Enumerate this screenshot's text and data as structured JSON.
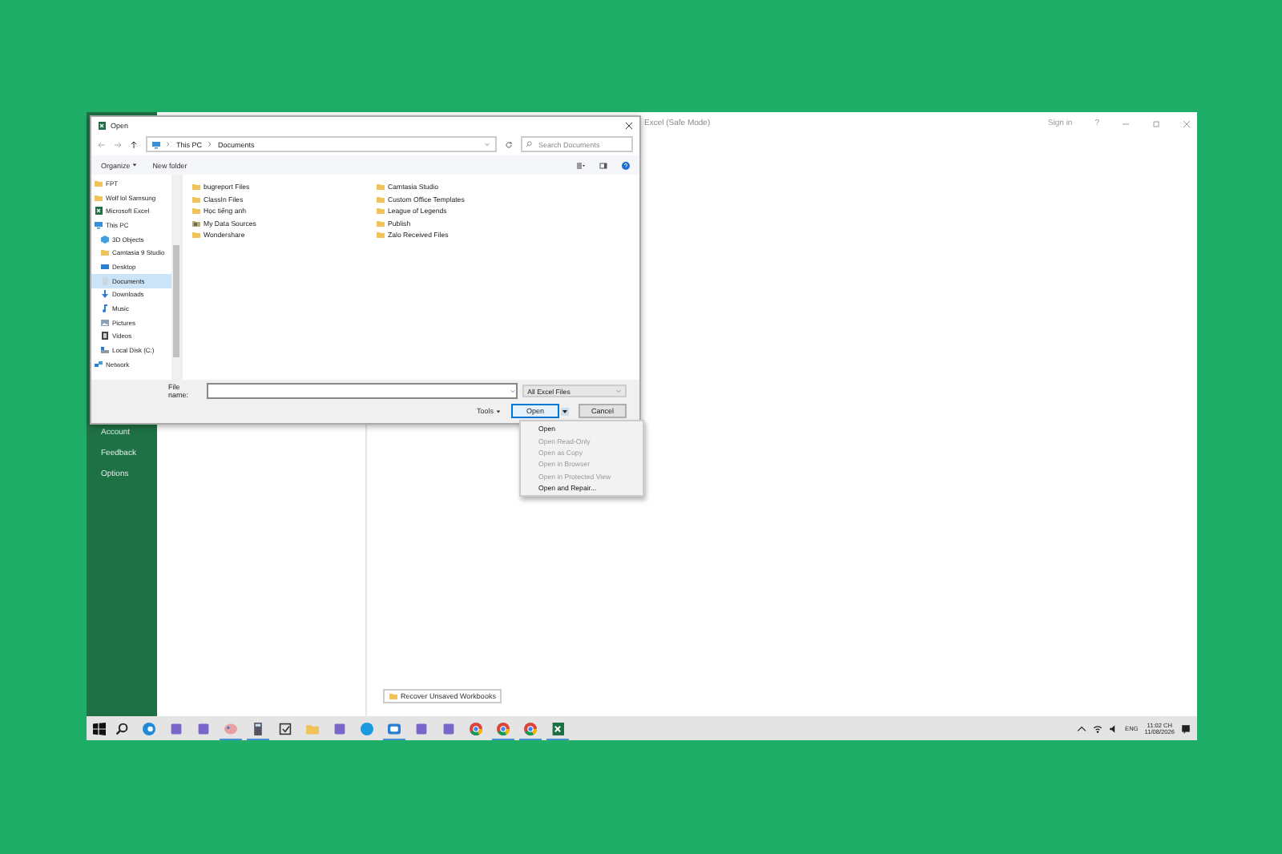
{
  "excel": {
    "title": "Excel (Safe Mode)",
    "sign_in": "Sign in",
    "help": "?",
    "backstage": [
      {
        "label": "Account"
      },
      {
        "label": "Feedback"
      },
      {
        "label": "Options"
      }
    ],
    "recover_button": "Recover Unsaved Workbooks"
  },
  "dialog": {
    "title": "Open",
    "path": [
      "This PC",
      "Documents"
    ],
    "search": {
      "placeholder": "Search Documents"
    },
    "organize": "Organize",
    "new_folder": "New folder",
    "nav": [
      {
        "label": "FPT",
        "kind": "folder",
        "selected": false
      },
      {
        "label": "Wolf lol Samsung",
        "kind": "folder",
        "selected": false
      },
      {
        "label": "Microsoft Excel",
        "kind": "excel",
        "selected": false
      },
      {
        "label": "This PC",
        "kind": "pc",
        "selected": false,
        "children": [
          {
            "label": "3D Objects",
            "kind": "cube",
            "selected": false
          },
          {
            "label": "Camtasia 9 Studio",
            "kind": "folder",
            "selected": false
          },
          {
            "label": "Desktop",
            "kind": "desktop",
            "selected": false
          },
          {
            "label": "Documents",
            "kind": "docs",
            "selected": true
          },
          {
            "label": "Downloads",
            "kind": "download",
            "selected": false
          },
          {
            "label": "Music",
            "kind": "music",
            "selected": false
          },
          {
            "label": "Pictures",
            "kind": "pictures",
            "selected": false
          },
          {
            "label": "Videos",
            "kind": "videos",
            "selected": false
          },
          {
            "label": "Local Disk (C:)",
            "kind": "disk",
            "selected": false
          }
        ]
      },
      {
        "label": "Network",
        "kind": "network",
        "selected": false
      }
    ],
    "files": [
      {
        "name": "bugreport Files",
        "kind": "folder"
      },
      {
        "name": "ClassIn Files",
        "kind": "folder"
      },
      {
        "name": "Học tiếng anh",
        "kind": "folder"
      },
      {
        "name": "My Data Sources",
        "kind": "datasource"
      },
      {
        "name": "Wondershare",
        "kind": "folder"
      },
      {
        "name": "Camtasia Studio",
        "kind": "folder"
      },
      {
        "name": "Custom Office Templates",
        "kind": "folder"
      },
      {
        "name": "League of Legends",
        "kind": "folder"
      },
      {
        "name": "Publish",
        "kind": "folder"
      },
      {
        "name": "Zalo Received Files",
        "kind": "folder"
      }
    ],
    "file_name_label": "File name:",
    "filter": "All Excel Files",
    "tools": "Tools",
    "open": "Open",
    "cancel": "Cancel",
    "open_menu": [
      {
        "label": "Open",
        "disabled": false
      },
      {
        "label": "Open Read-Only",
        "disabled": true
      },
      {
        "label": "Open as Copy",
        "disabled": true
      },
      {
        "label": "Open in Browser",
        "disabled": true
      },
      {
        "label": "Open in Protected View",
        "disabled": true
      },
      {
        "label": "Open and Repair...",
        "disabled": false
      }
    ]
  },
  "taskbar": {
    "apps": [
      {
        "kind": "search",
        "running": false
      },
      {
        "kind": "edge",
        "running": false
      },
      {
        "kind": "app",
        "running": false
      },
      {
        "kind": "app",
        "running": false
      },
      {
        "kind": "paint",
        "running": true
      },
      {
        "kind": "calc",
        "running": true
      },
      {
        "kind": "check",
        "running": false
      },
      {
        "kind": "folder",
        "running": false
      },
      {
        "kind": "app",
        "running": false
      },
      {
        "kind": "skype",
        "running": false
      },
      {
        "kind": "zalo",
        "running": true
      },
      {
        "kind": "app",
        "running": false
      },
      {
        "kind": "app",
        "running": false
      },
      {
        "kind": "chrome",
        "running": false
      },
      {
        "kind": "chrome",
        "running": true
      },
      {
        "kind": "chrome",
        "running": true
      },
      {
        "kind": "excel",
        "running": true
      }
    ],
    "language": "ENG",
    "time": "11:02 CH",
    "date": "11/08/2026"
  }
}
